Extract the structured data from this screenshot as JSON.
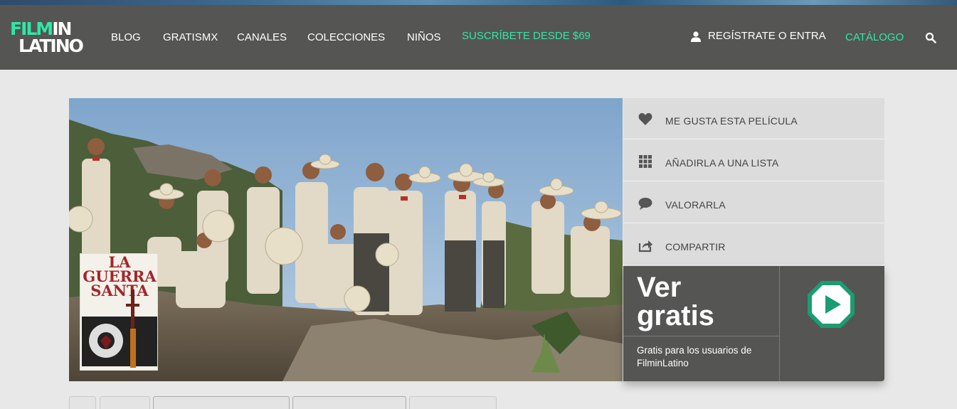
{
  "navbar": {
    "logo": {
      "line1_a": "FILM",
      "line1_b": "IN",
      "line2": "LATINO"
    },
    "items": [
      "BLOG",
      "GRATISMX",
      "CANALES",
      "COLECCIONES",
      "NIÑOS"
    ],
    "subscribe": "SUSCRÍBETE DESDE $69",
    "register": "REGÍSTRATE O ENTRA",
    "catalog": "CATÁLOGO"
  },
  "movie": {
    "poster_title": "LA GUERRA SANTA"
  },
  "actions": [
    "ME GUSTA ESTA PELÍCULA",
    "AÑADIRLA A UNA LISTA",
    "VALORARLA",
    "COMPARTIR"
  ],
  "watch": {
    "title_line1": "Ver",
    "title_line2": "gratis",
    "subtitle": "Gratis para los usuarios de FilminLatino"
  },
  "colors": {
    "accent": "#2ee8a6",
    "nav_bg": "#555553",
    "play_green": "#1a9d73"
  }
}
